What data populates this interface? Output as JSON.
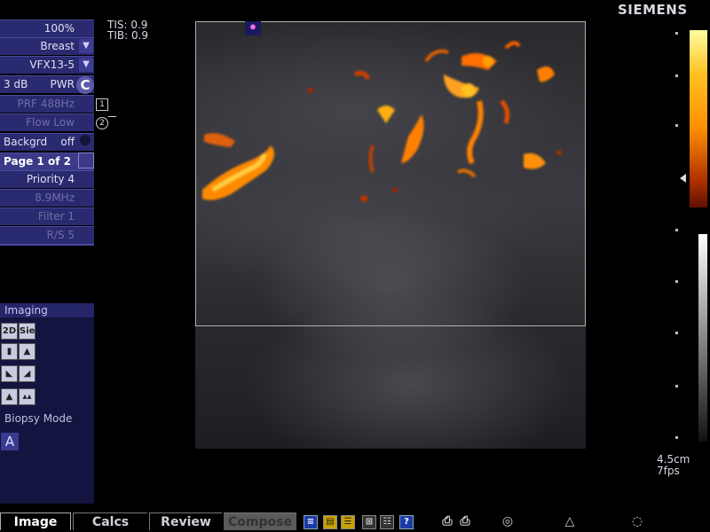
{
  "header": {
    "brand": "SIEMENS",
    "tis": "TIS: 0.9",
    "tib": "TIB: 0.9"
  },
  "params": {
    "zoom": "100%",
    "preset": "Breast",
    "transducer": "VFX13-5",
    "gain": "3 dB",
    "mode": "PWR",
    "mode_badge": "C",
    "prf": "PRF 488Hz",
    "flow": "Flow Low",
    "background_label": "Backgrd",
    "background_value": "off",
    "page": "Page 1 of 2",
    "priority": "Priority 4",
    "frequency": "8.9MHz",
    "filter": "Filter 1",
    "rs": "R/S 5"
  },
  "markers": {
    "one": "1",
    "two": "2"
  },
  "imaging": {
    "title": "Imaging",
    "btn_2d": "2D",
    "btn_sie": "Sie",
    "biopsy_label": "Biopsy Mode",
    "biopsy_btn": "A"
  },
  "display": {
    "depth": "4.5cm",
    "fps": "7fps"
  },
  "tabs": {
    "image": "Image",
    "calcs": "Calcs",
    "review": "Review",
    "compose": "Compose"
  },
  "icons": [
    "report-icon",
    "folder-icon",
    "notes-icon",
    "layout-icon",
    "list-icon",
    "help-icon",
    "printer1-icon",
    "printer2-icon",
    "probe1-icon",
    "probe2-icon",
    "probe3-icon"
  ],
  "colors": {
    "panel": "#2a2a70",
    "flow_hot": "#ff9000",
    "flow_dark": "#b03000"
  }
}
